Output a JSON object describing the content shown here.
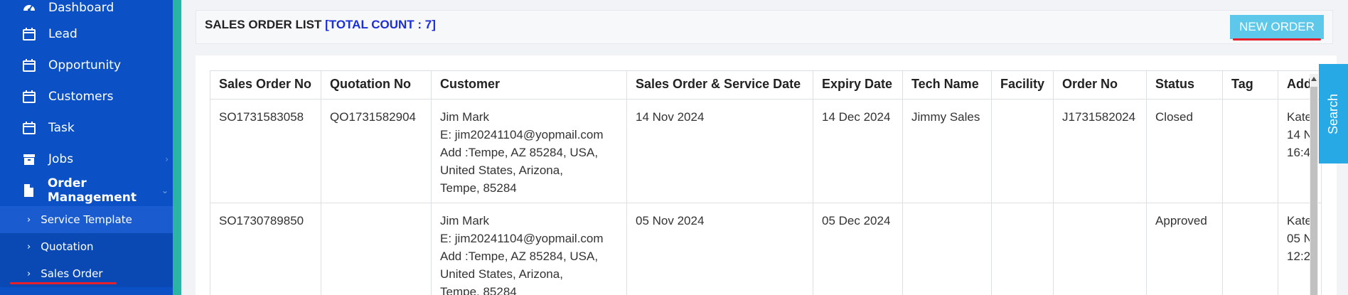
{
  "sidebar": {
    "items": [
      {
        "label": "Dashboard",
        "icon": "dashboard-icon"
      },
      {
        "label": "Lead",
        "icon": "calendar-icon"
      },
      {
        "label": "Opportunity",
        "icon": "calendar-icon"
      },
      {
        "label": "Customers",
        "icon": "calendar-icon"
      },
      {
        "label": "Task",
        "icon": "calendar-icon"
      },
      {
        "label": "Jobs",
        "icon": "archive-icon"
      },
      {
        "label": "Order Management",
        "icon": "document-icon"
      }
    ],
    "subitems": [
      {
        "label": "Service Template"
      },
      {
        "label": "Quotation"
      },
      {
        "label": "Sales Order"
      }
    ]
  },
  "header": {
    "title": "SALES ORDER LIST",
    "count": "[TOTAL COUNT : 7]",
    "new_order_label": "NEW ORDER"
  },
  "search_tab": {
    "label": "Search"
  },
  "table": {
    "columns": [
      "Sales Order No",
      "Quotation No",
      "Customer",
      "Sales Order & Service Date",
      "Expiry Date",
      "Tech Name",
      "Facility",
      "Order No",
      "Status",
      "Tag",
      "Add"
    ],
    "rows": [
      {
        "sales_order_no": "SO1731583058",
        "quotation_no": "QO1731582904",
        "customer": [
          "Jim Mark",
          "E: jim20241104@yopmail.com",
          "Add :Tempe, AZ 85284, USA,",
          "United States, Arizona,",
          "Tempe, 85284"
        ],
        "service_date": "14 Nov 2024",
        "expiry_date": "14 Dec 2024",
        "tech_name": "Jimmy Sales",
        "facility": "",
        "order_no": "J1731582024",
        "status": "Closed",
        "tag": "",
        "add": [
          "Kate",
          "14 N",
          "16:4"
        ]
      },
      {
        "sales_order_no": "SO1730789850",
        "quotation_no": "",
        "customer": [
          "Jim Mark",
          "E: jim20241104@yopmail.com",
          "Add :Tempe, AZ 85284, USA,",
          "United States, Arizona,",
          "Tempe, 85284"
        ],
        "service_date": "05 Nov 2024",
        "expiry_date": "05 Dec 2024",
        "tech_name": "",
        "facility": "",
        "order_no": "",
        "status": "Approved",
        "tag": "",
        "add": [
          "Kate",
          "05 N",
          "12:2"
        ]
      }
    ]
  },
  "colors": {
    "sidebar": "#0b51c5",
    "accent_teal": "#2bb3a3",
    "button": "#5ec8ea",
    "search_tab": "#27a9e6",
    "count_text": "#1b2fd6",
    "underline_red": "#e5202a"
  }
}
